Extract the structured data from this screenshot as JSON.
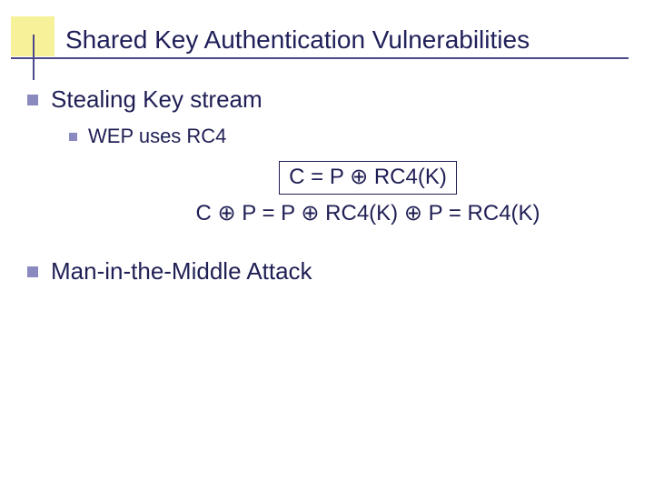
{
  "title": "Shared Key Authentication Vulnerabilities",
  "points": {
    "p1": "Stealing Key stream",
    "p1_1": "WEP uses RC4",
    "p2": "Man-in-the-Middle Attack"
  },
  "formula": {
    "line1": "C = P ⊕ RC4(K)",
    "line2": "C ⊕ P = P ⊕ RC4(K) ⊕ P = RC4(K)"
  }
}
